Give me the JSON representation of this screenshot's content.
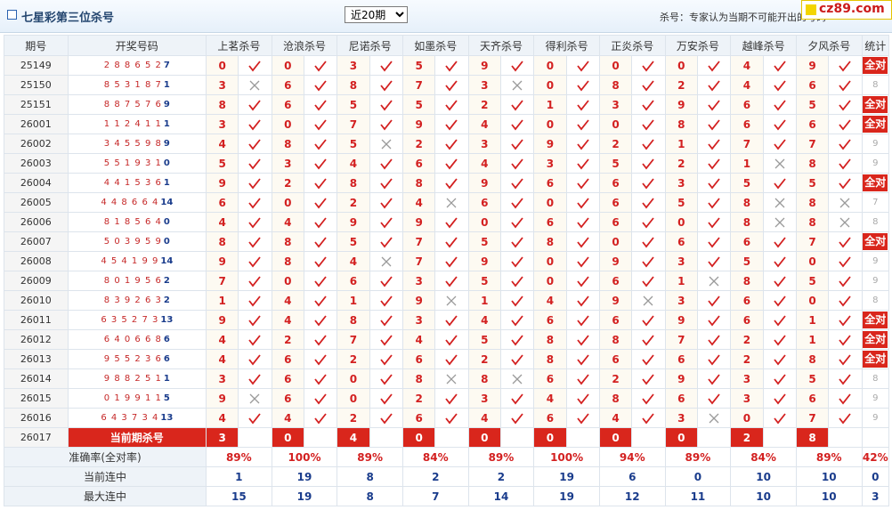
{
  "header": {
    "title": "七星彩第三位杀号",
    "period_select": {
      "selected": "近20期",
      "options": [
        "近20期"
      ]
    },
    "note": "杀号：专家认为当期不可能开出的号码",
    "logo_text": "cz89.com"
  },
  "table": {
    "col_period": "期号",
    "col_draw": "开奖号码",
    "col_stat": "统计",
    "experts": [
      "上茗杀号",
      "沧浪杀号",
      "尼诺杀号",
      "如墨杀号",
      "天齐杀号",
      "得利杀号",
      "正炎杀号",
      "万安杀号",
      "越峰杀号",
      "夕风杀号"
    ],
    "rows": [
      {
        "period": "25149",
        "draw": "288652",
        "last": "7",
        "kills": [
          "0",
          "0",
          "3",
          "5",
          "9",
          "0",
          "0",
          "0",
          "4",
          "9"
        ],
        "hits": [
          1,
          1,
          1,
          1,
          1,
          1,
          1,
          1,
          1,
          1
        ],
        "stat": "全对"
      },
      {
        "period": "25150",
        "draw": "853187",
        "last": "1",
        "kills": [
          "3",
          "6",
          "8",
          "7",
          "3",
          "0",
          "8",
          "2",
          "4",
          "6"
        ],
        "hits": [
          0,
          1,
          1,
          1,
          0,
          1,
          1,
          1,
          1,
          1
        ],
        "stat": "8"
      },
      {
        "period": "25151",
        "draw": "887576",
        "last": "9",
        "kills": [
          "8",
          "6",
          "5",
          "5",
          "2",
          "1",
          "3",
          "9",
          "6",
          "5"
        ],
        "hits": [
          1,
          1,
          1,
          1,
          1,
          1,
          1,
          1,
          1,
          1
        ],
        "stat": "全对"
      },
      {
        "period": "26001",
        "draw": "112411",
        "last": "1",
        "kills": [
          "3",
          "0",
          "7",
          "9",
          "4",
          "0",
          "0",
          "8",
          "6",
          "6"
        ],
        "hits": [
          1,
          1,
          1,
          1,
          1,
          1,
          1,
          1,
          1,
          1
        ],
        "stat": "全对"
      },
      {
        "period": "26002",
        "draw": "345598",
        "last": "9",
        "kills": [
          "4",
          "8",
          "5",
          "2",
          "3",
          "9",
          "2",
          "1",
          "7",
          "7"
        ],
        "hits": [
          1,
          1,
          0,
          1,
          1,
          1,
          1,
          1,
          1,
          1
        ],
        "stat": "9"
      },
      {
        "period": "26003",
        "draw": "551931",
        "last": "0",
        "kills": [
          "5",
          "3",
          "4",
          "6",
          "4",
          "3",
          "5",
          "2",
          "1",
          "8"
        ],
        "hits": [
          1,
          1,
          1,
          1,
          1,
          1,
          1,
          1,
          0,
          1
        ],
        "stat": "9"
      },
      {
        "period": "26004",
        "draw": "441536",
        "last": "1",
        "kills": [
          "9",
          "2",
          "8",
          "8",
          "9",
          "6",
          "6",
          "3",
          "5",
          "5"
        ],
        "hits": [
          1,
          1,
          1,
          1,
          1,
          1,
          1,
          1,
          1,
          1
        ],
        "stat": "全对"
      },
      {
        "period": "26005",
        "draw": "448664",
        "last": "14",
        "kills": [
          "6",
          "0",
          "2",
          "4",
          "6",
          "0",
          "6",
          "5",
          "8",
          "8"
        ],
        "hits": [
          1,
          1,
          1,
          0,
          1,
          1,
          1,
          1,
          0,
          0
        ],
        "stat": "7"
      },
      {
        "period": "26006",
        "draw": "818564",
        "last": "0",
        "kills": [
          "4",
          "4",
          "9",
          "9",
          "0",
          "6",
          "6",
          "0",
          "8",
          "8"
        ],
        "hits": [
          1,
          1,
          1,
          1,
          1,
          1,
          1,
          1,
          0,
          0
        ],
        "stat": "8"
      },
      {
        "period": "26007",
        "draw": "503959",
        "last": "0",
        "kills": [
          "8",
          "8",
          "5",
          "7",
          "5",
          "8",
          "0",
          "6",
          "6",
          "7"
        ],
        "hits": [
          1,
          1,
          1,
          1,
          1,
          1,
          1,
          1,
          1,
          1
        ],
        "stat": "全对"
      },
      {
        "period": "26008",
        "draw": "454199",
        "last": "14",
        "kills": [
          "9",
          "8",
          "4",
          "7",
          "9",
          "0",
          "9",
          "3",
          "5",
          "0"
        ],
        "hits": [
          1,
          1,
          0,
          1,
          1,
          1,
          1,
          1,
          1,
          1
        ],
        "stat": "9"
      },
      {
        "period": "26009",
        "draw": "801956",
        "last": "2",
        "kills": [
          "7",
          "0",
          "6",
          "3",
          "5",
          "0",
          "6",
          "1",
          "8",
          "5"
        ],
        "hits": [
          1,
          1,
          1,
          1,
          1,
          1,
          1,
          0,
          1,
          1
        ],
        "stat": "9"
      },
      {
        "period": "26010",
        "draw": "839263",
        "last": "2",
        "kills": [
          "1",
          "4",
          "1",
          "9",
          "1",
          "4",
          "9",
          "3",
          "6",
          "0"
        ],
        "hits": [
          1,
          1,
          1,
          0,
          1,
          1,
          0,
          1,
          1,
          1
        ],
        "stat": "8"
      },
      {
        "period": "26011",
        "draw": "635273",
        "last": "13",
        "kills": [
          "9",
          "4",
          "8",
          "3",
          "4",
          "6",
          "6",
          "9",
          "6",
          "1"
        ],
        "hits": [
          1,
          1,
          1,
          1,
          1,
          1,
          1,
          1,
          1,
          1
        ],
        "stat": "全对"
      },
      {
        "period": "26012",
        "draw": "640668",
        "last": "6",
        "kills": [
          "4",
          "2",
          "7",
          "4",
          "5",
          "8",
          "8",
          "7",
          "2",
          "1"
        ],
        "hits": [
          1,
          1,
          1,
          1,
          1,
          1,
          1,
          1,
          1,
          1
        ],
        "stat": "全对"
      },
      {
        "period": "26013",
        "draw": "955236",
        "last": "6",
        "kills": [
          "4",
          "6",
          "2",
          "6",
          "2",
          "8",
          "6",
          "6",
          "2",
          "8"
        ],
        "hits": [
          1,
          1,
          1,
          1,
          1,
          1,
          1,
          1,
          1,
          1
        ],
        "stat": "全对"
      },
      {
        "period": "26014",
        "draw": "988251",
        "last": "1",
        "kills": [
          "3",
          "6",
          "0",
          "8",
          "8",
          "6",
          "2",
          "9",
          "3",
          "5"
        ],
        "hits": [
          1,
          1,
          1,
          0,
          0,
          1,
          1,
          1,
          1,
          1
        ],
        "stat": "8"
      },
      {
        "period": "26015",
        "draw": "019911",
        "last": "5",
        "kills": [
          "9",
          "6",
          "0",
          "2",
          "3",
          "4",
          "8",
          "6",
          "3",
          "6"
        ],
        "hits": [
          0,
          1,
          1,
          1,
          1,
          1,
          1,
          1,
          1,
          1
        ],
        "stat": "9"
      },
      {
        "period": "26016",
        "draw": "643734",
        "last": "13",
        "kills": [
          "4",
          "4",
          "2",
          "6",
          "4",
          "6",
          "4",
          "3",
          "0",
          "7"
        ],
        "hits": [
          1,
          1,
          1,
          1,
          1,
          1,
          1,
          0,
          1,
          1
        ],
        "stat": "9"
      }
    ],
    "current": {
      "period": "26017",
      "label": "当前期杀号",
      "kills": [
        "3",
        "0",
        "4",
        "0",
        "0",
        "0",
        "0",
        "0",
        "2",
        "8"
      ]
    },
    "footer": [
      {
        "label": "准确率(全对率)",
        "kind": "acc",
        "values": [
          "89%",
          "100%",
          "89%",
          "84%",
          "89%",
          "100%",
          "94%",
          "89%",
          "84%",
          "89%"
        ],
        "stat": "42%"
      },
      {
        "label": "当前连中",
        "kind": "streak",
        "values": [
          "1",
          "19",
          "8",
          "2",
          "2",
          "19",
          "6",
          "0",
          "10",
          "10"
        ],
        "stat": "0"
      },
      {
        "label": "最大连中",
        "kind": "streak",
        "values": [
          "15",
          "19",
          "8",
          "7",
          "14",
          "19",
          "12",
          "11",
          "10",
          "10"
        ],
        "stat": "3"
      }
    ]
  },
  "colors": {
    "red": "#d9261c",
    "check": "#d32020",
    "cross": "#9a9a9a",
    "navy": "#1a3c8c"
  }
}
